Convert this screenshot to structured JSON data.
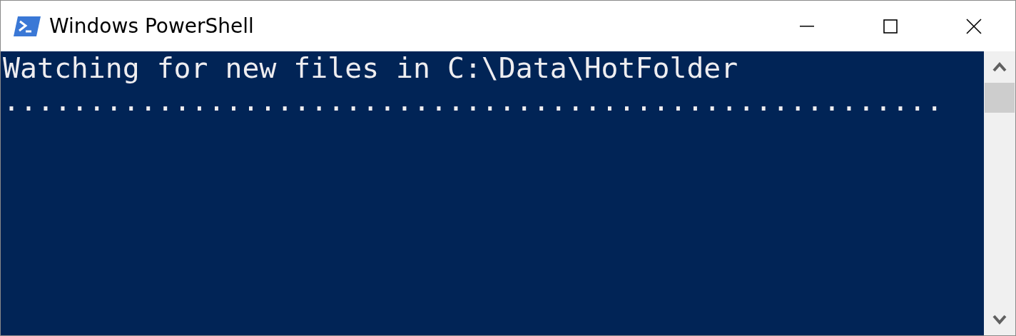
{
  "window": {
    "title": "Windows PowerShell"
  },
  "console": {
    "lines": [
      "Watching for new files in C:\\Data\\HotFolder",
      "......................................................."
    ]
  }
}
